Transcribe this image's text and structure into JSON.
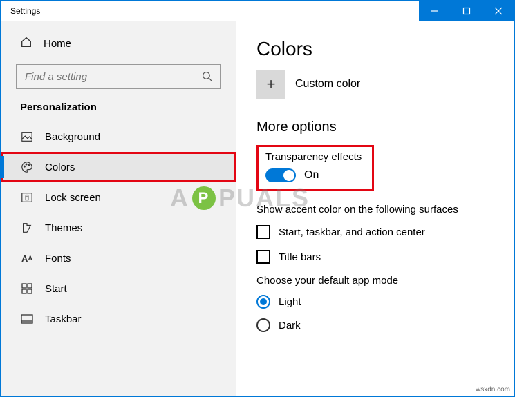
{
  "window": {
    "title": "Settings"
  },
  "sidebar": {
    "home": "Home",
    "search_placeholder": "Find a setting",
    "section": "Personalization",
    "items": [
      {
        "label": "Background"
      },
      {
        "label": "Colors"
      },
      {
        "label": "Lock screen"
      },
      {
        "label": "Themes"
      },
      {
        "label": "Fonts"
      },
      {
        "label": "Start"
      },
      {
        "label": "Taskbar"
      }
    ]
  },
  "main": {
    "title": "Colors",
    "custom_color": "Custom color",
    "more_options": "More options",
    "transparency_label": "Transparency effects",
    "transparency_state": "On",
    "accent_label": "Show accent color on the following surfaces",
    "check1": "Start, taskbar, and action center",
    "check2": "Title bars",
    "mode_label": "Choose your default app mode",
    "mode_light": "Light",
    "mode_dark": "Dark"
  },
  "watermark": {
    "a": "A",
    "p": "P",
    "rest": "PUALS"
  },
  "source": "wsxdn.com"
}
